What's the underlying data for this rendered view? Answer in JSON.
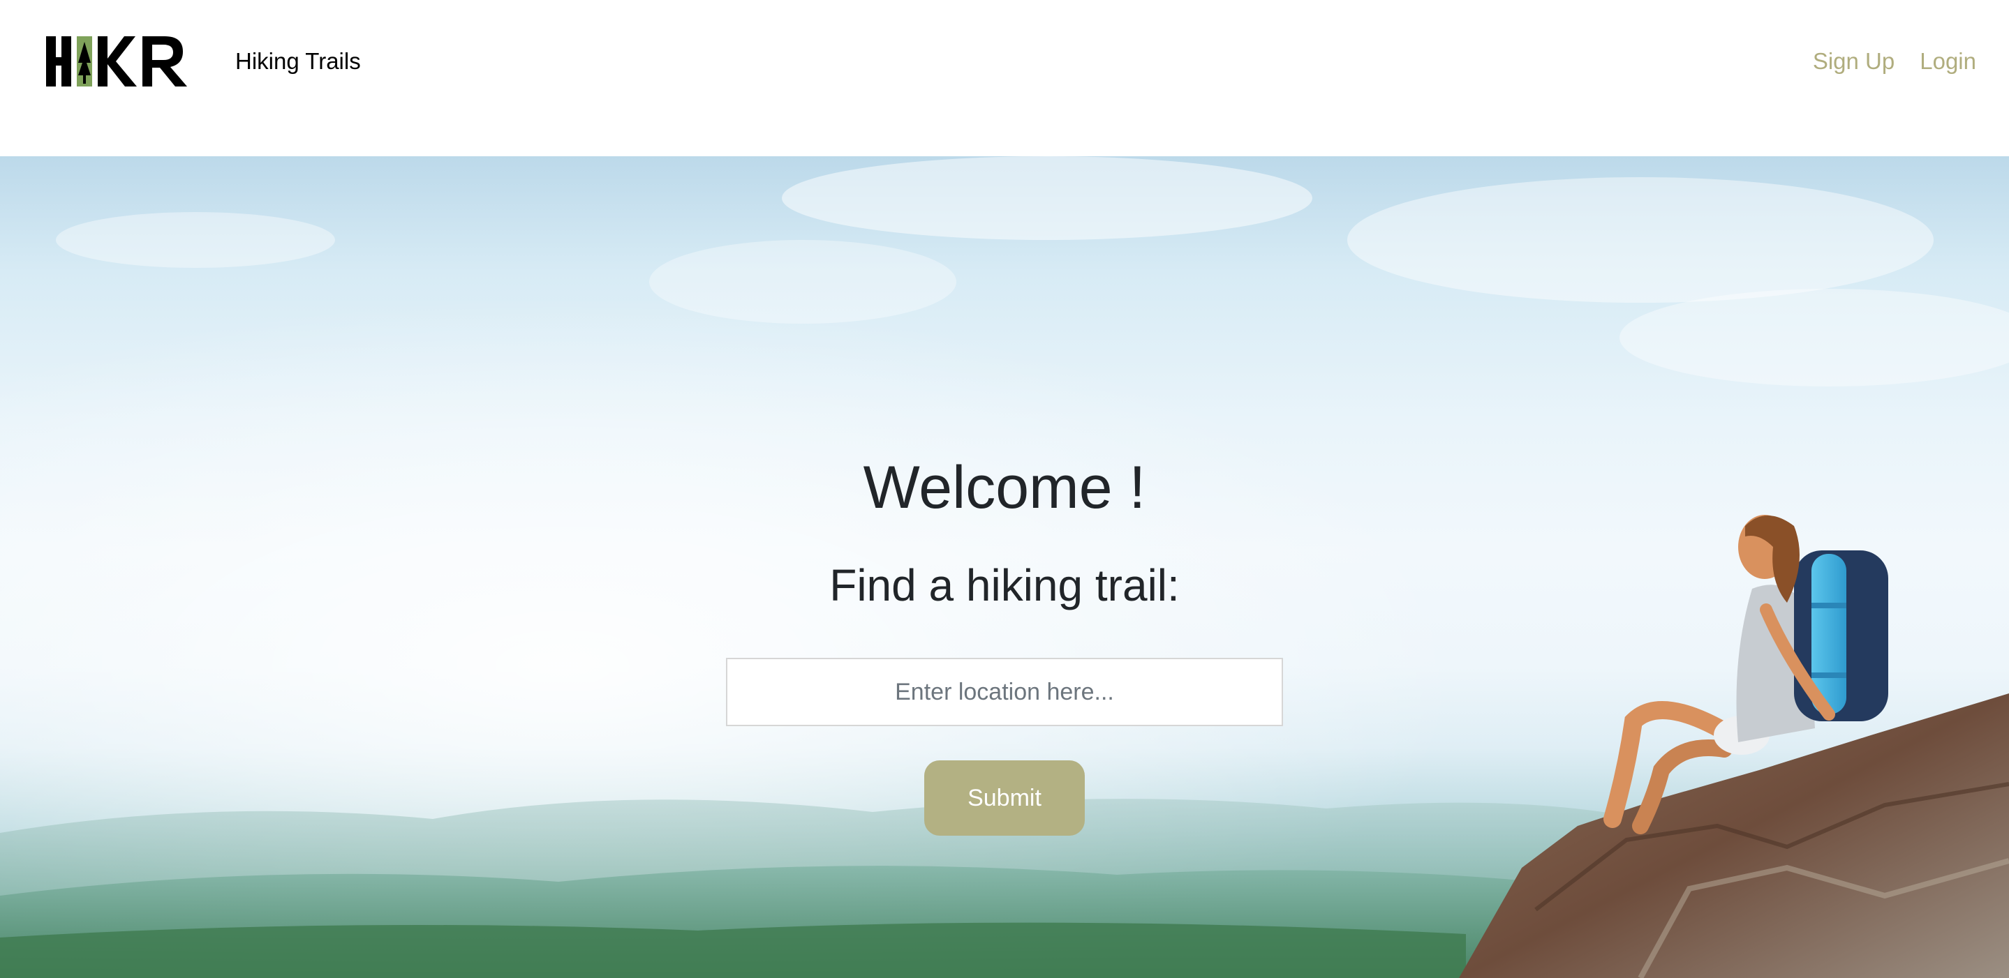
{
  "header": {
    "logo_text": "HIKR",
    "brand_link": "Hiking Trails",
    "nav": {
      "signup": "Sign Up",
      "login": "Login"
    },
    "nav_color": "#b0ad7e"
  },
  "hero": {
    "welcome": "Welcome !",
    "subtitle": "Find a hiking trail:",
    "search": {
      "placeholder": "Enter location here...",
      "value": ""
    },
    "submit_label": "Submit",
    "submit_color": "#b3b183"
  }
}
